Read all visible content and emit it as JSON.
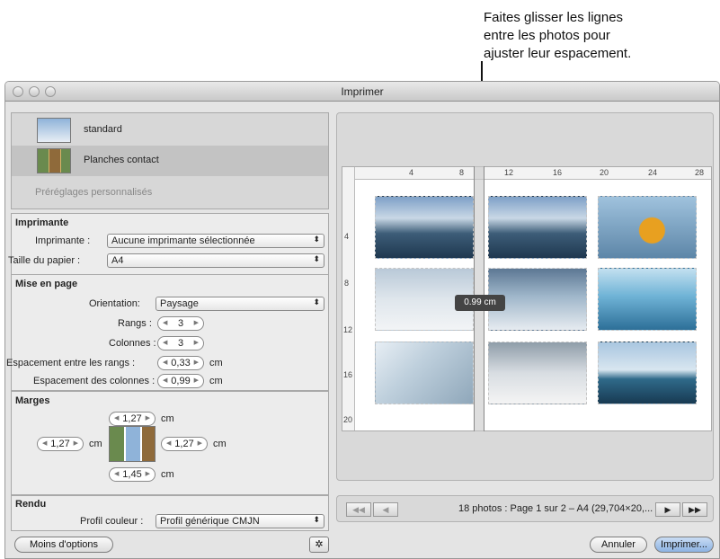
{
  "callout": {
    "line1": "Faites glisser les lignes",
    "line2": "entre les photos pour",
    "line3": "ajuster leur espacement."
  },
  "window": {
    "title": "Imprimer"
  },
  "presets": {
    "items": [
      {
        "label": "standard"
      },
      {
        "label": "Planches contact"
      }
    ],
    "custom": "Préréglages personnalisés"
  },
  "printer": {
    "section_title": "Imprimante",
    "printer_label": "Imprimante :",
    "printer_value": "Aucune imprimante sélectionnée",
    "paper_label": "Taille du papier :",
    "paper_value": "A4"
  },
  "layout": {
    "section_title": "Mise en page",
    "orientation_label": "Orientation:",
    "orientation_value": "Paysage",
    "rows_label": "Rangs :",
    "rows_value": "3",
    "cols_label": "Colonnes :",
    "cols_value": "3",
    "rowspace_label": "Espacement entre les rangs :",
    "rowspace_value": "0,33",
    "colspace_label": "Espacement des colonnes :",
    "colspace_value": "0,99",
    "unit": "cm"
  },
  "margins": {
    "section_title": "Marges",
    "top": "1,27",
    "left": "1,27",
    "right": "1,27",
    "bottom": "1,45",
    "unit": "cm"
  },
  "render": {
    "section_title": "Rendu",
    "profile_label": "Profil couleur :",
    "profile_value": "Profil générique CMJN"
  },
  "buttons": {
    "fewer_options": "Moins d'options",
    "gear": "✲",
    "cancel": "Annuler",
    "print": "Imprimer..."
  },
  "preview": {
    "ruler_ticks": [
      "4",
      "8",
      "12",
      "16",
      "20",
      "24",
      "28"
    ],
    "vruler_ticks": [
      "4",
      "8",
      "12",
      "16",
      "20"
    ],
    "spacing_tooltip": "0.99 cm",
    "page_info": "18 photos : Page 1 sur 2 – A4 (29,704×20,...",
    "nav_first": "◀◀",
    "nav_prev": "◀",
    "nav_next": "▶",
    "nav_last": "▶▶"
  },
  "colors": {
    "window_bg": "#e4e4e4",
    "default_button": "#8cb2e2"
  }
}
